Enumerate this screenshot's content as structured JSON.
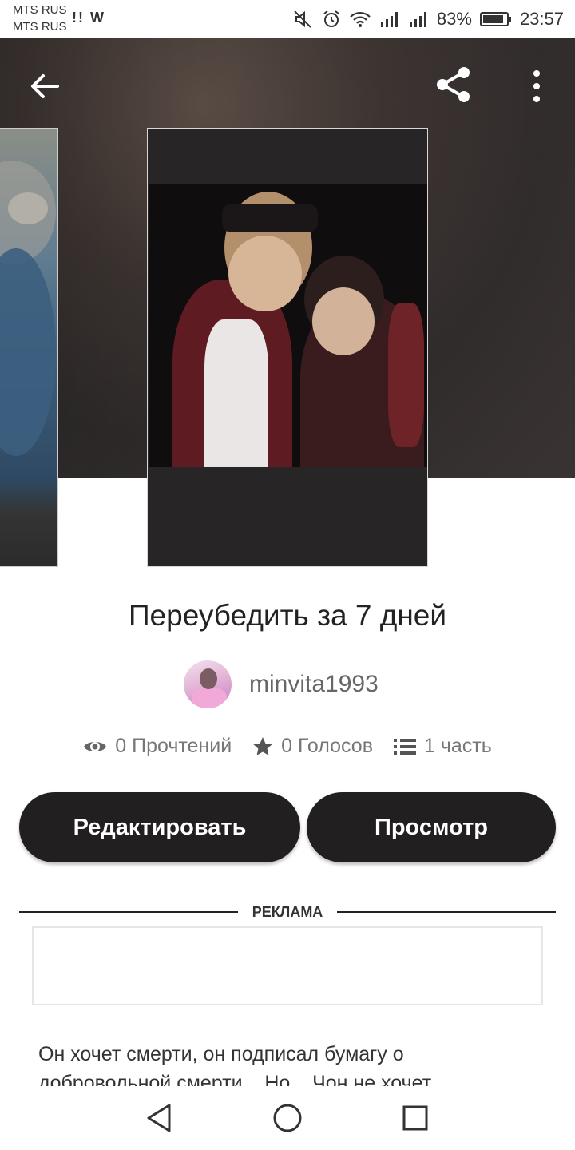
{
  "status_bar": {
    "carrier_1": "MTS RUS",
    "carrier_2": "MTS RUS",
    "app_icons": "!! W",
    "battery_percent": "83%",
    "time": "23:57",
    "icons": [
      "mute-icon",
      "alarm-icon",
      "wifi-icon",
      "signal-icon",
      "signal-icon",
      "battery-icon"
    ]
  },
  "toolbar": {
    "back_icon": "arrow-left",
    "share_icon": "share",
    "more_icon": "more-vertical"
  },
  "story": {
    "title": "Переубедить за 7 дней",
    "author": "minvita1993",
    "reads": "0 Прочтений",
    "votes": "0 Голосов",
    "parts": "1 часть",
    "description": "Он хочет смерти, он подписал бумагу о добровольной смерти... Но... Чон не хочет"
  },
  "actions": {
    "edit_label": "Редактировать",
    "view_label": "Просмотр"
  },
  "ad": {
    "label": "РЕКЛАМА"
  },
  "colors": {
    "button_bg": "#221f20",
    "header_bg": "#3a3332"
  }
}
